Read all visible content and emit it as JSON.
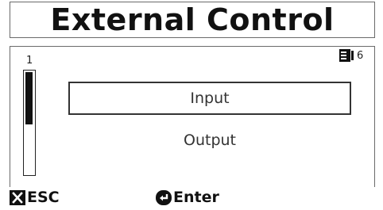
{
  "header": {
    "title": "External Control"
  },
  "scroll": {
    "index": "1",
    "position": 0.5
  },
  "page_indicator": {
    "icon": "list-icon",
    "count": "6"
  },
  "menu": {
    "items": [
      {
        "label": "Input",
        "selected": true
      },
      {
        "label": "Output",
        "selected": false
      }
    ]
  },
  "softkeys": {
    "esc": {
      "icon": "close-icon",
      "label": "ESC"
    },
    "enter": {
      "icon": "enter-icon",
      "label": "Enter"
    }
  }
}
